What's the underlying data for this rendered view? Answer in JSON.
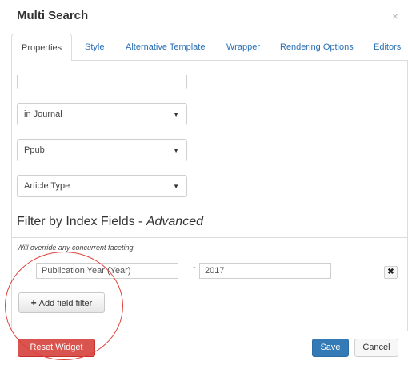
{
  "dialog": {
    "title": "Multi Search",
    "close_glyph": "×"
  },
  "tabs": [
    {
      "label": "Properties",
      "active": true
    },
    {
      "label": "Style"
    },
    {
      "label": "Alternative Template"
    },
    {
      "label": "Wrapper"
    },
    {
      "label": "Rendering Options"
    },
    {
      "label": "Editors"
    }
  ],
  "selects": [
    {
      "value": "in Journal"
    },
    {
      "value": "Ppub"
    },
    {
      "value": "Article Type"
    }
  ],
  "filter": {
    "title": "Filter by Index Fields - ",
    "title_italic": "Advanced",
    "hint": "Will override any concurrent faceting.",
    "field_value": "Publication Year (Year)",
    "separator": "-",
    "range_value": "2017",
    "remove_glyph": "✖",
    "add_label": "Add field filter",
    "add_icon": "plus-icon"
  },
  "footer": {
    "reset_label": "Reset Widget",
    "save_label": "Save",
    "cancel_label": "Cancel"
  },
  "colors": {
    "link": "#2a6fb3",
    "danger": "#d9534f",
    "primary": "#337ab7",
    "annotation": "#e0413a"
  }
}
